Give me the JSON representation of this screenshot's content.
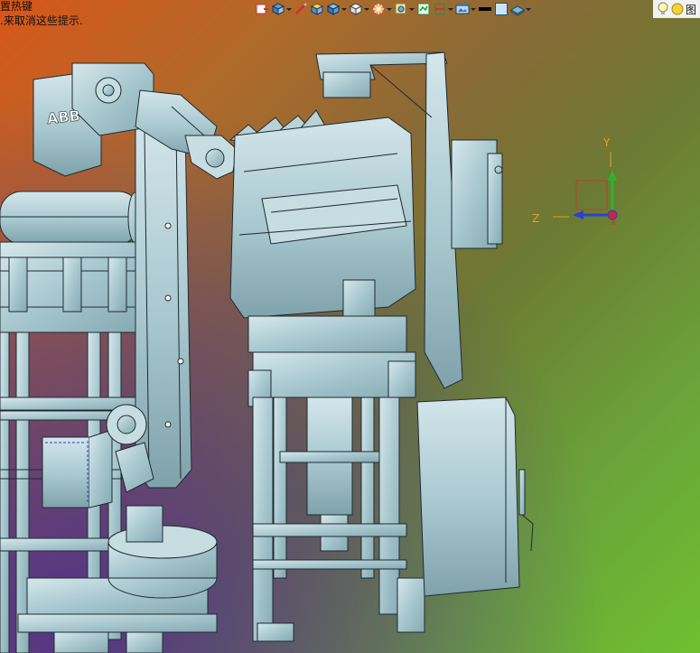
{
  "hint": {
    "line1": "置热键",
    "line2": ".来取消这些提示."
  },
  "toolbar": {
    "items": [
      {
        "name": "view-orientation-icon"
      },
      {
        "name": "display-style-icon",
        "dropdown": true
      },
      {
        "name": "edit-appearance-icon"
      },
      {
        "name": "section-view-icon"
      },
      {
        "name": "shaded-with-edges-icon",
        "dropdown": true
      },
      {
        "name": "view-cube-icon",
        "dropdown": true
      },
      {
        "name": "render-settings-icon",
        "dropdown": true
      },
      {
        "name": "zoom-icon",
        "dropdown": true
      },
      {
        "name": "hide-show-icon"
      },
      {
        "name": "section-plane-icon",
        "dropdown": true
      },
      {
        "name": "scene-icon",
        "dropdown": true
      },
      {
        "name": "line-color-icon"
      },
      {
        "name": "background-color-icon"
      },
      {
        "name": "appearance-icon",
        "dropdown": true
      }
    ],
    "end_label": "图"
  },
  "triad": {
    "x_label": "X",
    "y_label": "Y",
    "z_label": "Z"
  },
  "model": {
    "brand_text": "ABB"
  },
  "colors": {
    "part_fill": "#a8c7cf",
    "part_fill_light": "#c6dde2",
    "part_fill_dark": "#7ea3ad",
    "edge": "#1f2a30",
    "axis_x": "#cc2a2a",
    "axis_y": "#2db52d",
    "axis_z": "#2a3fd6"
  }
}
